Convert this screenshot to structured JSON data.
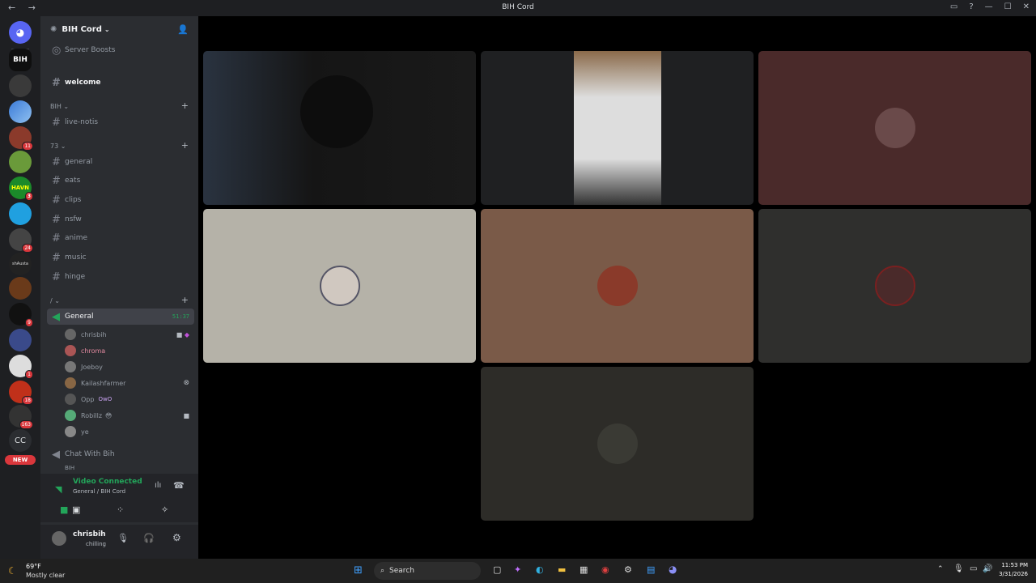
{
  "titlebar": {
    "title": "BIH Cord",
    "nav": "← →"
  },
  "servers": [
    {
      "name": "discord-home",
      "color": "#5865f2"
    },
    {
      "name": "BIH",
      "color": "#0f0f0f",
      "label": "BIH"
    },
    {
      "name": "server-2",
      "color": "#3a3a3a"
    },
    {
      "name": "server-3",
      "color": "#3b7bd8"
    },
    {
      "name": "server-4",
      "color": "#8b3a2b",
      "badge": "11"
    },
    {
      "name": "server-5",
      "color": "#6a9a3a"
    },
    {
      "name": "server-6",
      "color": "#1b8a2a",
      "label": "HAVN",
      "badge": "3"
    },
    {
      "name": "server-7",
      "color": "#20a0e0"
    },
    {
      "name": "server-8",
      "color": "#444",
      "badge": "24"
    },
    {
      "name": "server-9",
      "color": "#222",
      "label": "shAusta"
    },
    {
      "name": "server-10",
      "color": "#6a3a1a"
    },
    {
      "name": "server-11",
      "color": "#111",
      "badge": "9"
    },
    {
      "name": "server-12",
      "color": "#3a4a8a"
    },
    {
      "name": "server-13",
      "color": "#ddd",
      "badge": "1"
    },
    {
      "name": "server-14",
      "color": "#c0301a",
      "badge": "18"
    },
    {
      "name": "server-15",
      "color": "#333",
      "badge": "163"
    },
    {
      "name": "server-16",
      "color": "#2b2d31",
      "label": "CC"
    },
    {
      "name": "new",
      "color": "#da373c",
      "label": "NEW"
    }
  ],
  "guild": {
    "name": "BIH Cord",
    "server_boosts": "Server Boosts",
    "welcome": "welcome",
    "cat1": "BIH",
    "live_notis": "live-notis",
    "cat2": "73",
    "channels": [
      "general",
      "eats",
      "clips",
      "nsfw",
      "anime",
      "music",
      "hinge"
    ],
    "cat3": "/",
    "voice_general": "General",
    "voice_timer": "51:37",
    "members": [
      {
        "name": "chrisbih",
        "color": "#b5bac1"
      },
      {
        "name": "chroma",
        "color": "#e38aa0"
      },
      {
        "name": "Joeboy",
        "color": "#b5bac1"
      },
      {
        "name": "Kailashfarmer",
        "color": "#b5bac1"
      },
      {
        "name": "Opp",
        "color": "#b5bac1",
        "tag": "OwO"
      },
      {
        "name": "Robillz",
        "color": "#b5bac1"
      },
      {
        "name": "ye",
        "color": "#b5bac1"
      }
    ],
    "chat_with_bih": "Chat With Bih",
    "hidden_ch": "BIH"
  },
  "voice": {
    "status": "Video Connected",
    "location": "General / BIH Cord"
  },
  "user": {
    "name": "chrisbih",
    "status": "chilling"
  },
  "taskbar": {
    "weather_temp": "69°F",
    "weather_desc": "Mostly clear",
    "search": "Search",
    "time": "11:53 PM",
    "date": "3/31/2026"
  }
}
